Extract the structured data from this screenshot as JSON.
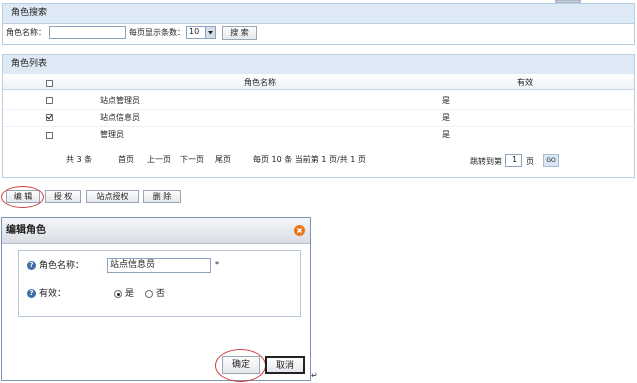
{
  "search_panel": {
    "title": "角色搜索",
    "role_name_label": "角色名称：",
    "role_name_value": "",
    "page_size_label": "每页显示条数：",
    "page_size_value": "10",
    "search_button": "搜 索"
  },
  "list_panel": {
    "title": "角色列表",
    "columns": {
      "select": "",
      "name": "角色名称",
      "valid": "有效"
    },
    "rows": [
      {
        "name": "站点管理员",
        "valid": "是",
        "checked": false
      },
      {
        "name": "站点信息员",
        "valid": "是",
        "checked": true
      },
      {
        "name": "管理员",
        "valid": "是",
        "checked": false
      }
    ],
    "pager": {
      "total": "共 3 条",
      "first": "首页",
      "prev": "上一页",
      "next": "下一页",
      "last": "尾页",
      "info": "每页 10 条 当前第 1 页/共 1 页",
      "jump_label": "跳转到第",
      "jump_value": "1",
      "page_suffix": "页",
      "go_button": "GO"
    }
  },
  "toolbar": {
    "edit": "编 辑",
    "grant": "授 权",
    "site_grant": "站点授权",
    "delete": "删 除"
  },
  "dialog": {
    "title": "编辑角色",
    "name_label": "角色名称：",
    "name_value": "站点信息员",
    "required_mark": "*",
    "valid_label": "有效：",
    "yes_label": "是",
    "no_label": "否",
    "yes_selected": true,
    "ok_button": "确定",
    "cancel_button": "取消"
  },
  "icons": {
    "help": "help-circle-icon",
    "close": "close-icon",
    "dropdown": "dropdown-arrow-icon",
    "return_mark": "return-mark-icon"
  },
  "colors": {
    "panel_header": "#dde9f4",
    "panel_border": "#b9cfe0",
    "highlight_ellipse": "#d04040",
    "close_icon": "#e8761c"
  }
}
